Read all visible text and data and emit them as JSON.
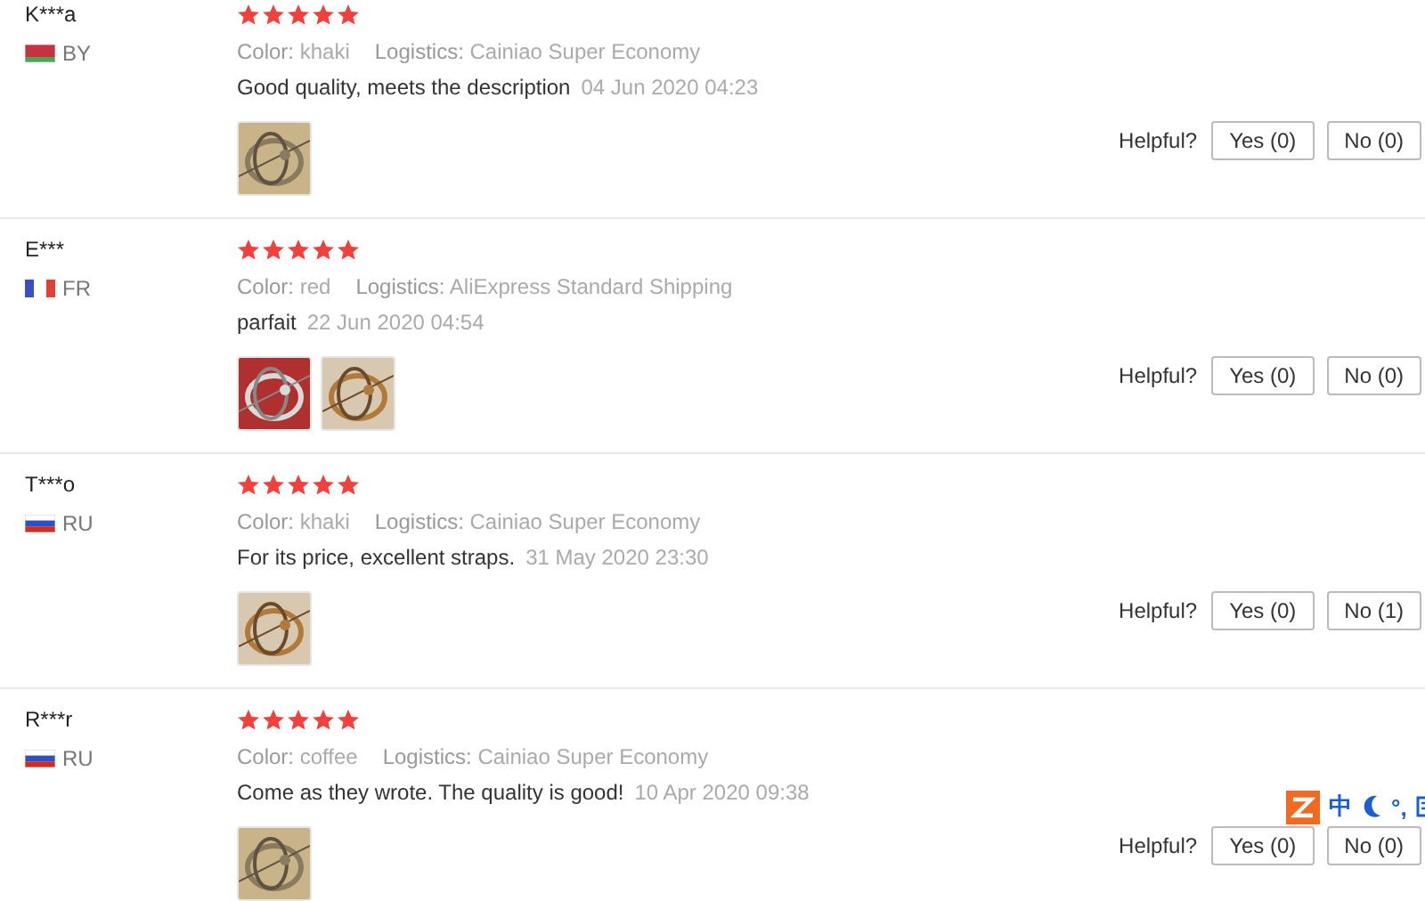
{
  "reviews": [
    {
      "user": "K***a",
      "flag": {
        "kind": "by"
      },
      "country": "BY",
      "stars": 5,
      "color_label": "Color:",
      "color_value": "khaki",
      "logistics_label": "Logistics:",
      "logistics": "Cainiao Super Economy",
      "text": "Good quality, meets the description",
      "date": "04 Jun 2020 04:23",
      "photos": [
        {
          "kind": "picture"
        }
      ],
      "helpful": "Helpful?",
      "yes": "Yes (0)",
      "no": "No (0)"
    },
    {
      "user": "E***",
      "flag": {
        "kind": "fr"
      },
      "country": "FR",
      "stars": 5,
      "color_label": "Color:",
      "color_value": "red",
      "logistics_label": "Logistics:",
      "logistics": "AliExpress Standard Shipping",
      "text": "parfait",
      "date": "22 Jun 2020 04:54",
      "photos": [
        {
          "kind": "picture"
        },
        {
          "kind": "picture"
        }
      ],
      "helpful": "Helpful?",
      "yes": "Yes (0)",
      "no": "No (0)"
    },
    {
      "user": "T***o",
      "flag": {
        "kind": "ru"
      },
      "country": "RU",
      "stars": 5,
      "color_label": "Color:",
      "color_value": "khaki",
      "logistics_label": "Logistics:",
      "logistics": "Cainiao Super Economy",
      "text": "For its price, excellent straps.",
      "date": "31 May 2020 23:30",
      "photos": [
        {
          "kind": "picture"
        }
      ],
      "helpful": "Helpful?",
      "yes": "Yes (0)",
      "no": "No (1)"
    },
    {
      "user": "R***r",
      "flag": {
        "kind": "ru"
      },
      "country": "RU",
      "stars": 5,
      "color_label": "Color:",
      "color_value": "coffee",
      "logistics_label": "Logistics:",
      "logistics": "Cainiao Super Economy",
      "text": "Come as they wrote. The quality is good!",
      "date": "10 Apr 2020 09:38",
      "photos": [
        {
          "kind": "picture"
        }
      ],
      "helpful": "Helpful?",
      "yes": "Yes (0)",
      "no": "No (0)"
    }
  ],
  "ime": {
    "mode": "中",
    "punctuation": "°,"
  }
}
